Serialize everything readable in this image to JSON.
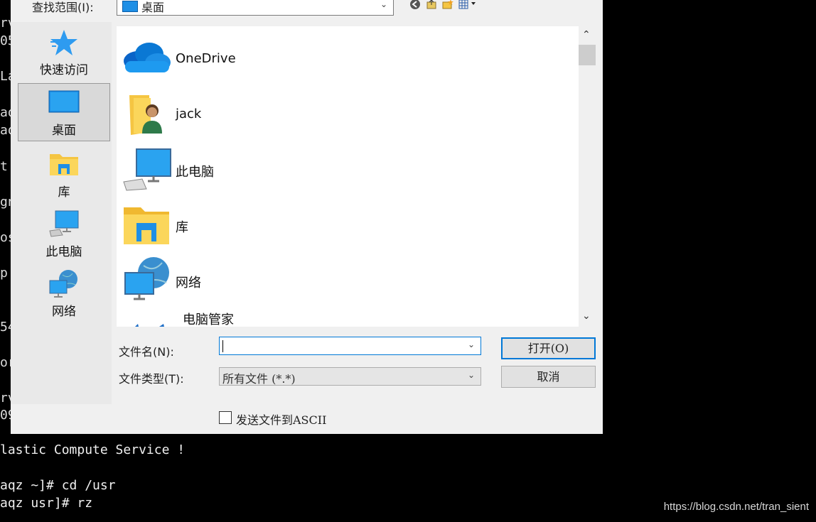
{
  "terminal": {
    "left_fragments": [
      "rv",
      "05",
      "La",
      "aq",
      "aq",
      "t",
      "gn",
      "os",
      "p",
      "54",
      "or",
      "rv",
      "09"
    ],
    "lines": [
      "lastic Compute Service !",
      "",
      "aqz ~]# cd /usr",
      "aqz usr]# rz"
    ]
  },
  "watermark": "https://blog.csdn.net/tran_sient",
  "dialog": {
    "look_in_label": "查找范围(I):",
    "look_in_value": "桌面",
    "toolbar_icons": [
      "back-icon",
      "up-folder-icon",
      "new-folder-icon",
      "view-menu-icon"
    ],
    "places": [
      {
        "label": "快速访问",
        "icon": "star-icon"
      },
      {
        "label": "桌面",
        "icon": "desktop-icon",
        "selected": true
      },
      {
        "label": "库",
        "icon": "library-icon"
      },
      {
        "label": "此电脑",
        "icon": "computer-icon"
      },
      {
        "label": "网络",
        "icon": "network-icon"
      }
    ],
    "files": [
      {
        "name": "OneDrive",
        "icon": "cloud-icon"
      },
      {
        "name": "jack",
        "icon": "user-folder-icon"
      },
      {
        "name": "此电脑",
        "icon": "computer-icon"
      },
      {
        "name": "库",
        "icon": "library-icon"
      },
      {
        "name": "网络",
        "icon": "network-icon"
      },
      {
        "name": "电脑管家",
        "icon": "shield-app-icon"
      }
    ],
    "filename_label": "文件名(N):",
    "filename_value": "",
    "filetype_label": "文件类型(T):",
    "filetype_value": "所有文件 (*.*)",
    "open_button": "打开(O)",
    "cancel_button": "取消",
    "ascii_checkbox_label": "发送文件到ASCII",
    "ascii_checked": false
  },
  "colors": {
    "accent": "#0078d7",
    "folder": "#f5c542",
    "screen": "#1e8fe6"
  }
}
